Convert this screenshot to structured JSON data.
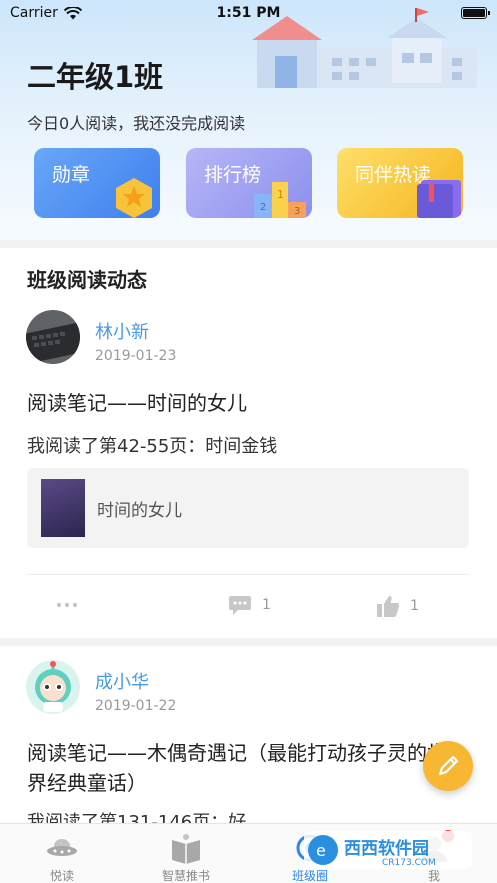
{
  "status_bar": {
    "carrier": "Carrier",
    "time": "1:51 PM"
  },
  "header": {
    "class_title": "二年级1班",
    "reading_status": "今日0人阅读，我还没完成阅读"
  },
  "cards": [
    {
      "label": "勋章",
      "icon": "medal-icon"
    },
    {
      "label": "排行榜",
      "icon": "podium-icon"
    },
    {
      "label": "同伴热读",
      "icon": "book-icon"
    }
  ],
  "section_title": "班级阅读动态",
  "posts": [
    {
      "author": "林小新",
      "date": "2019-01-23",
      "title": "阅读笔记——时间的女儿",
      "text": "我阅读了第42-55页：时间金钱",
      "book_title": "时间的女儿",
      "comments": "1",
      "likes": "1"
    },
    {
      "author": "成小华",
      "date": "2019-01-22",
      "title": "阅读笔记——木偶奇遇记（最能打动孩子灵的世界经典童话）",
      "text": "我阅读了第131-146页：好"
    }
  ],
  "tabs": [
    {
      "label": "悦读",
      "icon": "ufo-icon"
    },
    {
      "label": "智慧推书",
      "icon": "books-icon"
    },
    {
      "label": "班级圈",
      "icon": "circle-icon"
    },
    {
      "label": "我",
      "icon": "profile-icon"
    }
  ],
  "colors": {
    "accent": "#4a9be0",
    "active_tab": "#2d87f0",
    "fab": "#f7b733"
  },
  "watermark": {
    "text": "西西软件园",
    "sub": "CR173.COM"
  }
}
